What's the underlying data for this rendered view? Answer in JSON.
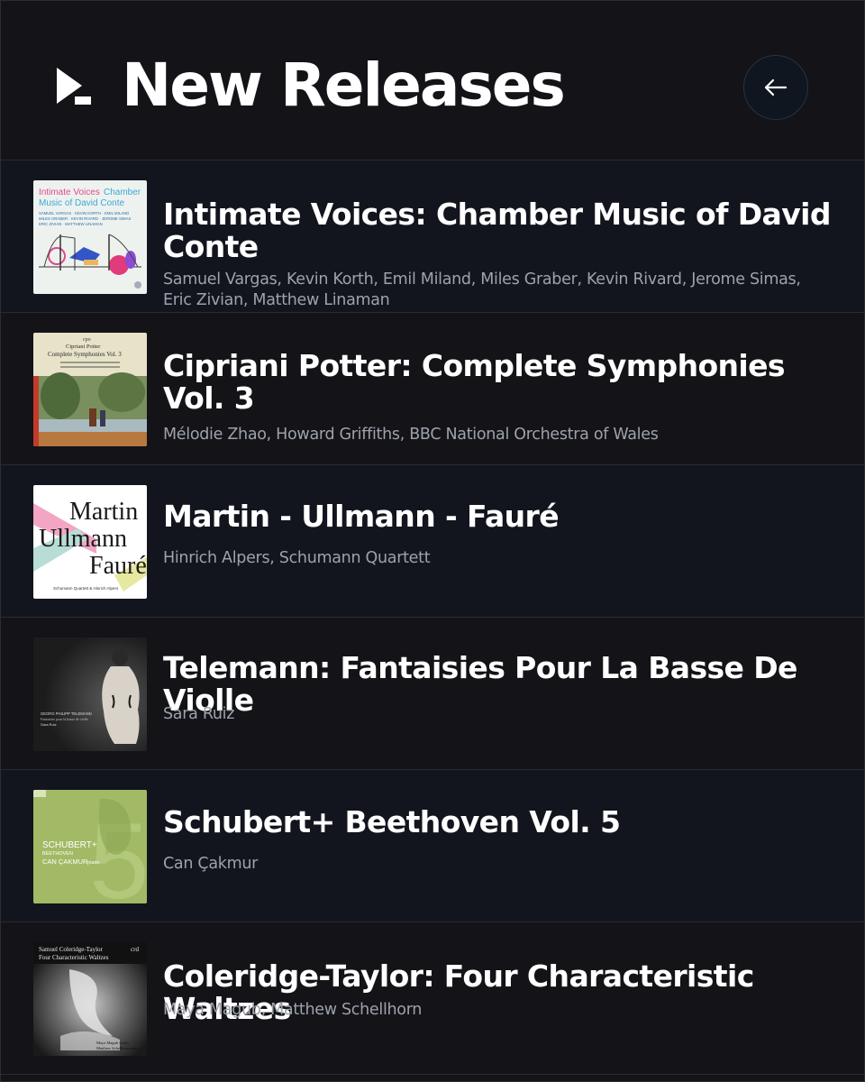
{
  "header": {
    "title": "New Releases",
    "logo_icon": "brand-play-logo-icon",
    "back_icon": "arrow-left-icon"
  },
  "colors": {
    "background": "#131318",
    "row_alt": "#12151d",
    "text": "#ffffff",
    "subtext": "#9da2ab"
  },
  "releases": [
    {
      "title": "Intimate Voices: Chamber Music of David Conte",
      "artists": "Samuel Vargas, Kevin Korth, Emil Miland, Miles Graber, Kevin Rivard, Jerome Simas, Eric Zivian, Matthew Linaman",
      "cover": {
        "line1a": "Intimate Voices",
        "line1b": "Chamber",
        "line2": "Music of David Conte",
        "credits1": "SAMUEL VARGAS · KEVIN KORTH · EMIL MILAND",
        "credits2": "MILES GRABER · KEVIN RIVARD · JEROME SIMAS",
        "credits3": "ERIC ZIVIAN · MATTHEW LINAMAN"
      }
    },
    {
      "title": "Cipriani Potter: Complete Symphonies Vol. 3",
      "artists": "Mélodie Zhao, Howard Griffiths, BBC National Orchestra of Wales",
      "cover": {
        "label": "cpo",
        "line1": "Cipriani Potter",
        "line2": "Complete Symphonies Vol. 3"
      }
    },
    {
      "title": "Martin - Ullmann - Fauré",
      "artists": "Hinrich Alpers, Schumann Quartett",
      "cover": {
        "word1": "Martin",
        "word2": "Ullmann",
        "word3": "Fauré",
        "footer": "Schumann Quartett & Hinrich Alpers"
      }
    },
    {
      "title": "Telemann: Fantaisies Pour La Basse De Violle",
      "artists": "Sara Ruiz",
      "cover": {
        "line1": "GEORG PHILIPP TELEMANN",
        "line2": "Fantaisies pour la basse de violle",
        "line3": "Sara Ruiz"
      }
    },
    {
      "title": "Schubert+ Beethoven Vol. 5",
      "artists": "Can Çakmur",
      "cover": {
        "line1": "SCHUBERT+",
        "line2": "BEETHOVEN",
        "line3": "CAN ÇAKMUR",
        "line3b": "piano",
        "numeral": "5"
      }
    },
    {
      "title": "Coleridge-Taylor: Four Characteristic Waltzes",
      "artists": "Maya Magub, Matthew Schellhorn",
      "cover": {
        "line1": "Samuel Coleridge-Taylor",
        "line2": "Four Characteristic Waltzes",
        "label": "crd",
        "credit1": "Maya Magub violin",
        "credit2": "Matthew Schellhorn piano"
      }
    }
  ]
}
